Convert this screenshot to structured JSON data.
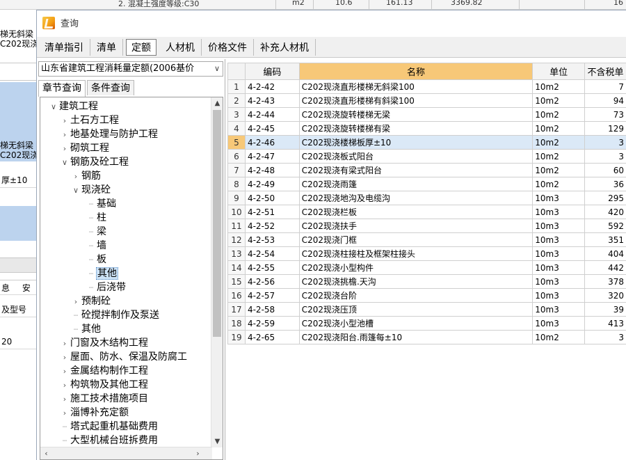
{
  "window": {
    "title": "查询"
  },
  "background": {
    "top_strip": [
      "2. 混凝土强度等级:C30",
      "m2",
      "10.6",
      "161.13",
      "3369.82",
      "16"
    ],
    "rows": [
      "梯无斜梁",
      "C202现浇砼",
      "梯无斜梁",
      "C202现浇砼",
      "厚±10",
      "息",
      "安",
      "及型号",
      "20"
    ]
  },
  "toolbar": {
    "tabs": [
      "清单指引",
      "清单",
      "定额",
      "人材机",
      "价格文件",
      "补充人材机"
    ],
    "active": "定额"
  },
  "library": {
    "selected": "山东省建筑工程消耗量定额(2006基价"
  },
  "left_tabs": {
    "chapter": "章节查询",
    "condition": "条件查询"
  },
  "tree": [
    {
      "label": "建筑工程",
      "toggle": "▾",
      "level": 0
    },
    {
      "label": "土石方工程",
      "toggle": "›",
      "level": 1
    },
    {
      "label": "地基处理与防护工程",
      "toggle": "›",
      "level": 1
    },
    {
      "label": "砌筑工程",
      "toggle": "›",
      "level": 1
    },
    {
      "label": "钢筋及砼工程",
      "toggle": "▾",
      "level": 1
    },
    {
      "label": "钢筋",
      "toggle": "›",
      "level": 2
    },
    {
      "label": "现浇砼",
      "toggle": "▾",
      "level": 2
    },
    {
      "label": "基础",
      "toggle": "",
      "level": 3
    },
    {
      "label": "柱",
      "toggle": "",
      "level": 3
    },
    {
      "label": "梁",
      "toggle": "",
      "level": 3
    },
    {
      "label": "墙",
      "toggle": "",
      "level": 3
    },
    {
      "label": "板",
      "toggle": "",
      "level": 3
    },
    {
      "label": "其他",
      "toggle": "",
      "level": 3,
      "selected": true
    },
    {
      "label": "后浇带",
      "toggle": "",
      "level": 3
    },
    {
      "label": "预制砼",
      "toggle": "›",
      "level": 2
    },
    {
      "label": "砼搅拌制作及泵送",
      "toggle": "",
      "level": 2
    },
    {
      "label": "其他",
      "toggle": "",
      "level": 2
    },
    {
      "label": "门窗及木结构工程",
      "toggle": "›",
      "level": 1
    },
    {
      "label": "屋面、防水、保温及防腐工",
      "toggle": "›",
      "level": 1
    },
    {
      "label": "金属结构制作工程",
      "toggle": "›",
      "level": 1
    },
    {
      "label": "构筑物及其他工程",
      "toggle": "›",
      "level": 1
    },
    {
      "label": "施工技术措施项目",
      "toggle": "›",
      "level": 1
    },
    {
      "label": "淄博补充定额",
      "toggle": "›",
      "level": 1
    },
    {
      "label": "塔式起重机基础费用",
      "toggle": "",
      "level": 1
    },
    {
      "label": "大型机械台班拆费用",
      "toggle": "",
      "level": 1
    }
  ],
  "table": {
    "headers": [
      "编码",
      "名称",
      "单位",
      "不含税单"
    ],
    "rows": [
      {
        "n": "1",
        "code": "4-2-42",
        "name": "C202现浇直形楼梯无斜梁100",
        "unit": "10m2",
        "price": "7"
      },
      {
        "n": "2",
        "code": "4-2-43",
        "name": "C202现浇直形楼梯有斜梁100",
        "unit": "10m2",
        "price": "94"
      },
      {
        "n": "3",
        "code": "4-2-44",
        "name": "C202现浇旋转楼梯无梁",
        "unit": "10m2",
        "price": "73"
      },
      {
        "n": "4",
        "code": "4-2-45",
        "name": "C202现浇旋转楼梯有梁",
        "unit": "10m2",
        "price": "129"
      },
      {
        "n": "5",
        "code": "4-2-46",
        "name": "C202现浇楼梯板厚±10",
        "unit": "10m2",
        "price": "3",
        "selected": true
      },
      {
        "n": "6",
        "code": "4-2-47",
        "name": "C202现浇板式阳台",
        "unit": "10m2",
        "price": "3"
      },
      {
        "n": "7",
        "code": "4-2-48",
        "name": "C202现浇有梁式阳台",
        "unit": "10m2",
        "price": "60"
      },
      {
        "n": "8",
        "code": "4-2-49",
        "name": "C202现浇雨篷",
        "unit": "10m2",
        "price": "36"
      },
      {
        "n": "9",
        "code": "4-2-50",
        "name": "C202现浇地沟及电缆沟",
        "unit": "10m3",
        "price": "295"
      },
      {
        "n": "10",
        "code": "4-2-51",
        "name": "C202现浇栏板",
        "unit": "10m3",
        "price": "420"
      },
      {
        "n": "11",
        "code": "4-2-52",
        "name": "C202现浇扶手",
        "unit": "10m3",
        "price": "592"
      },
      {
        "n": "12",
        "code": "4-2-53",
        "name": "C202现浇门框",
        "unit": "10m3",
        "price": "351"
      },
      {
        "n": "13",
        "code": "4-2-54",
        "name": "C202现浇柱接柱及框架柱接头",
        "unit": "10m3",
        "price": "404"
      },
      {
        "n": "14",
        "code": "4-2-55",
        "name": "C202现浇小型构件",
        "unit": "10m3",
        "price": "442"
      },
      {
        "n": "15",
        "code": "4-2-56",
        "name": "C202现浇挑檐.天沟",
        "unit": "10m3",
        "price": "378"
      },
      {
        "n": "16",
        "code": "4-2-57",
        "name": "C202现浇台阶",
        "unit": "10m3",
        "price": "320"
      },
      {
        "n": "17",
        "code": "4-2-58",
        "name": "C202现浇压顶",
        "unit": "10m3",
        "price": "39"
      },
      {
        "n": "18",
        "code": "4-2-59",
        "name": "C202现浇小型池槽",
        "unit": "10m3",
        "price": "413"
      },
      {
        "n": "19",
        "code": "4-2-65",
        "name": "C202现浇阳台.雨篷每±10",
        "unit": "10m2",
        "price": "3"
      }
    ]
  }
}
